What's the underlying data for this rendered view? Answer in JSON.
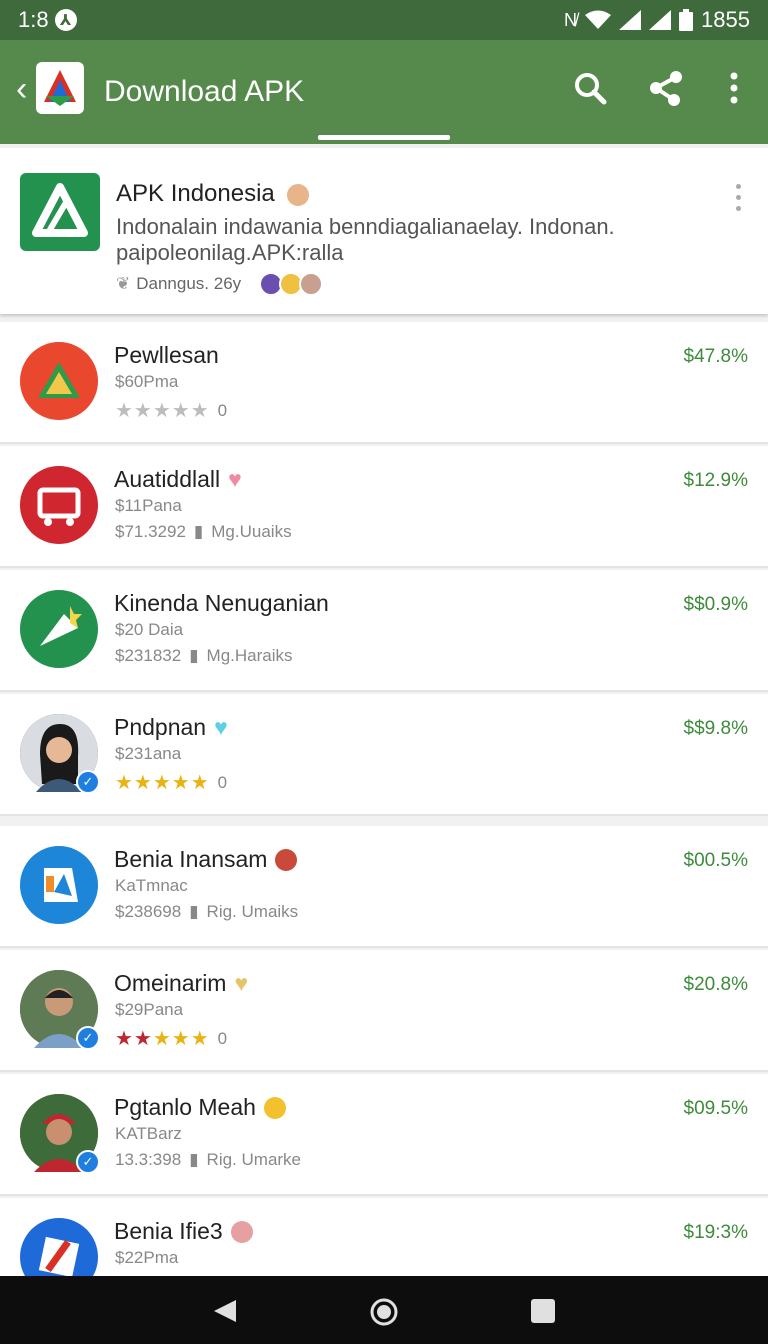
{
  "status": {
    "time": "1:8",
    "right_text": "1855"
  },
  "appbar": {
    "title": "Download APK"
  },
  "featured": {
    "name": "APK Indonesia",
    "description": "Indonalain indawania benndiagalianaelay. Indonan. paipoleonilag.APK:ralla",
    "meta": "Danngus. 26y"
  },
  "apps": [
    {
      "name": "Pewllesan",
      "sub": "$60Pma",
      "meta": "",
      "rating_text": "0",
      "stars_style": "grey",
      "price": "$47.8%",
      "icon_color": "#e9472e",
      "verified": false
    },
    {
      "name": "Auatiddlall",
      "sub": "$11Pana",
      "meta": "$71.3292",
      "meta2": "Mg.Uuaiks",
      "price": "$12.9%",
      "icon_color": "#d0262f",
      "verified": false
    },
    {
      "name": "Kinenda Nenuganian",
      "sub": "$20 Daia",
      "meta": "$231832",
      "meta2": "Mg.Haraiks",
      "price": "$$0.9%",
      "icon_color": "#23924e",
      "verified": false
    },
    {
      "name": "Pndpnan",
      "sub": "$231ana",
      "meta": "",
      "rating_text": "0",
      "stars_style": "gold",
      "price": "$$9.8%",
      "icon_color": "#3a4a5a",
      "verified": true
    },
    {
      "name": "Benia Inansam",
      "sub": "KaTmnac",
      "meta": "$238698",
      "meta2": "Rig. Umaiks",
      "price": "$00.5%",
      "icon_color": "#1e86d8",
      "verified": false
    },
    {
      "name": "Omeinarim",
      "sub": "$29Pana",
      "meta": "",
      "rating_text": "0",
      "stars_style": "mixed",
      "price": "$20.8%",
      "icon_color": "#4d6b58",
      "verified": true
    },
    {
      "name": "Pgtanlo Meah",
      "sub": "KATBarz",
      "meta": "13.3:398",
      "meta2": "Rig. Umarke",
      "price": "$09.5%",
      "icon_color": "#7a3030",
      "verified": true
    },
    {
      "name": "Benia Ifie3",
      "sub": "$22Pma",
      "meta": "",
      "price": "$19:3%",
      "icon_color": "#1e6ad8",
      "verified": false
    }
  ]
}
